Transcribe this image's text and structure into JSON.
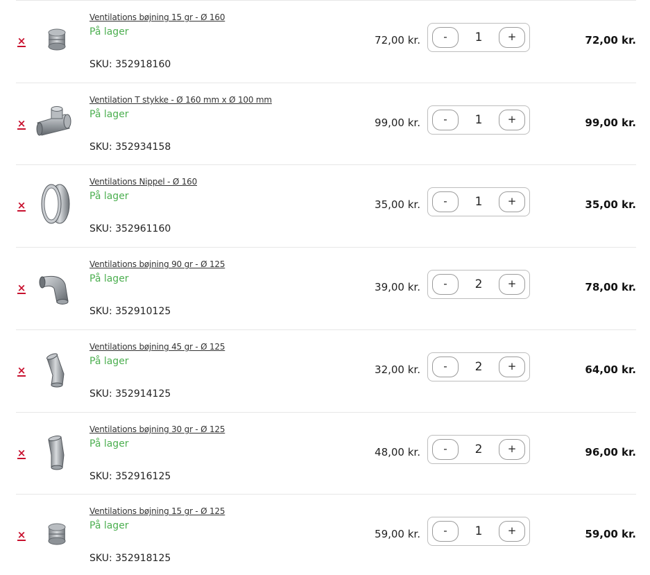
{
  "cart": {
    "items": [
      {
        "name": "Ventilations bøjning 15 gr - Ø 160",
        "stock": "På lager",
        "sku": "SKU: 352918160",
        "unit_price": "72,00 kr.",
        "quantity": "1",
        "total": "72,00 kr.",
        "image": "straight-duct-collar-image",
        "minus": "-",
        "plus": "+",
        "remove": "×"
      },
      {
        "name": "Ventilation T stykke - Ø 160 mm x Ø 100 mm",
        "stock": "På lager",
        "sku": "SKU: 352934158",
        "unit_price": "99,00 kr.",
        "quantity": "1",
        "total": "99,00 kr.",
        "image": "t-piece-duct-image",
        "minus": "-",
        "plus": "+",
        "remove": "×"
      },
      {
        "name": "Ventilations Nippel - Ø 160",
        "stock": "På lager",
        "sku": "SKU: 352961160",
        "unit_price": "35,00 kr.",
        "quantity": "1",
        "total": "35,00 kr.",
        "image": "duct-nipple-ring-image",
        "minus": "-",
        "plus": "+",
        "remove": "×"
      },
      {
        "name": "Ventilations bøjning 90 gr - Ø 125",
        "stock": "På lager",
        "sku": "SKU: 352910125",
        "unit_price": "39,00 kr.",
        "quantity": "2",
        "total": "78,00 kr.",
        "image": "elbow-90-image",
        "minus": "-",
        "plus": "+",
        "remove": "×"
      },
      {
        "name": "Ventilations bøjning 45 gr - Ø 125",
        "stock": "På lager",
        "sku": "SKU: 352914125",
        "unit_price": "32,00 kr.",
        "quantity": "2",
        "total": "64,00 kr.",
        "image": "elbow-45-image",
        "minus": "-",
        "plus": "+",
        "remove": "×"
      },
      {
        "name": "Ventilations bøjning 30 gr - Ø 125",
        "stock": "På lager",
        "sku": "SKU: 352916125",
        "unit_price": "48,00 kr.",
        "quantity": "2",
        "total": "96,00 kr.",
        "image": "elbow-30-image",
        "minus": "-",
        "plus": "+",
        "remove": "×"
      },
      {
        "name": "Ventilations bøjning 15 gr - Ø 125",
        "stock": "På lager",
        "sku": "SKU: 352918125",
        "unit_price": "59,00 kr.",
        "quantity": "1",
        "total": "59,00 kr.",
        "image": "straight-duct-collar-image",
        "minus": "-",
        "plus": "+",
        "remove": "×"
      }
    ]
  },
  "colors": {
    "remove": "#c8102e",
    "in_stock": "#4caf50",
    "divider": "#e6e6e6"
  }
}
